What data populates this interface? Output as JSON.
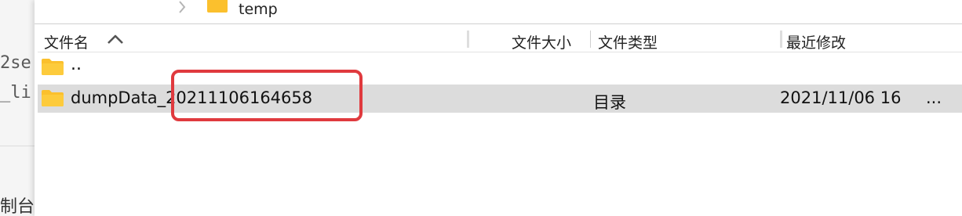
{
  "background_window": {
    "fragments": [
      "2se",
      "_li",
      "制台"
    ]
  },
  "tree": {
    "item_label": "temp",
    "folder_color": "#FBC02D"
  },
  "table": {
    "columns": {
      "name": "文件名",
      "size": "文件大小",
      "type": "文件类型",
      "modified": "最近修改"
    },
    "sort_direction": "ascending",
    "rows": [
      {
        "name": "..",
        "size": "",
        "type": "",
        "modified": "",
        "more": ""
      },
      {
        "name": "dumpData_20211106164658",
        "size": "",
        "type": "目录",
        "modified": "2021/11/06 16",
        "more": "...",
        "selected": true
      }
    ]
  },
  "colors": {
    "selected_row": "#dcdcdc",
    "annotation_border": "#e03a3e",
    "folder": "#FBC02D"
  }
}
